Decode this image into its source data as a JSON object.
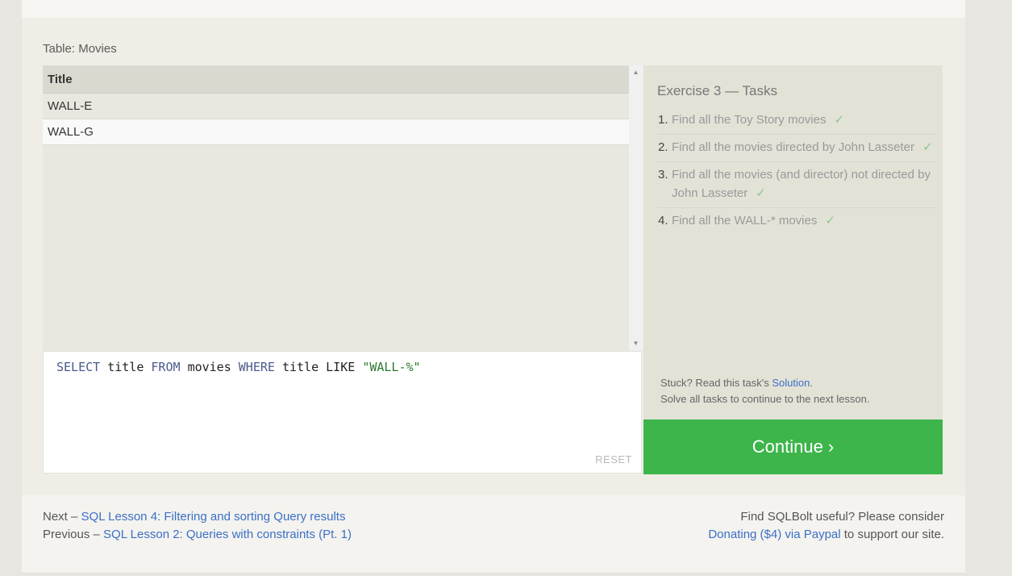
{
  "table_caption": "Table: Movies",
  "results": {
    "header": "Title",
    "rows": [
      "WALL-E",
      "WALL-G"
    ]
  },
  "editor": {
    "kw_select": "SELECT",
    "col": "title",
    "kw_from": "FROM",
    "table": "movies",
    "kw_where": "WHERE",
    "col2": "title",
    "op": "LIKE",
    "pattern": "\"WALL-%\"",
    "reset_label": "RESET"
  },
  "tasks": {
    "title": "Exercise 3 — Tasks",
    "items": [
      {
        "num": "1.",
        "text": "Find all the Toy Story movies",
        "check": "✓"
      },
      {
        "num": "2.",
        "text": "Find all the movies directed by John Lasseter",
        "check": "✓"
      },
      {
        "num": "3.",
        "text": "Find all the movies (and director) not directed by John Lasseter",
        "check": "✓"
      },
      {
        "num": "4.",
        "text": "Find all the WALL-* movies",
        "check": "✓"
      }
    ],
    "stuck_prefix": "Stuck? Read this task's",
    "solution_link": "Solution",
    "stuck_suffix": ".",
    "solve_all": "Solve all tasks to continue to the next lesson."
  },
  "continue_label": "Continue ›",
  "footer": {
    "next_prefix": "Next –",
    "next_link": "SQL Lesson 4: Filtering and sorting Query results",
    "prev_prefix": "Previous –",
    "prev_link": "SQL Lesson 2: Queries with constraints (Pt. 1)",
    "useful_text": "Find SQLBolt useful? Please consider",
    "donate_link": "Donating ($4) via Paypal",
    "support_text": "to support our site."
  },
  "scroll_up_glyph": "▲",
  "scroll_down_glyph": "▼"
}
